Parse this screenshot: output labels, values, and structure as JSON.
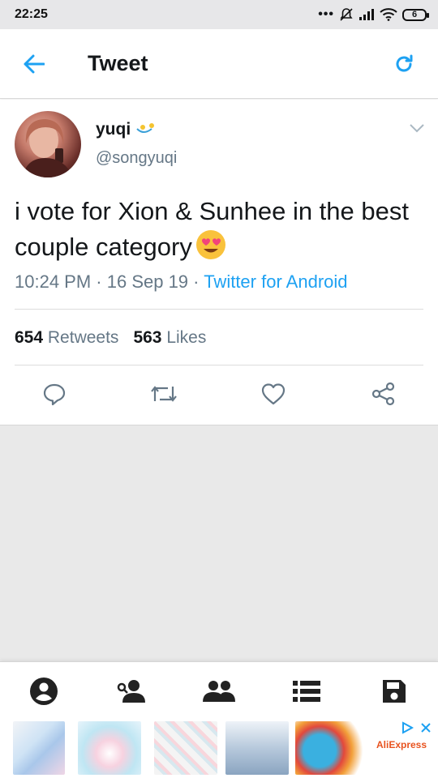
{
  "status_bar": {
    "time": "22:25",
    "battery": "6"
  },
  "header": {
    "title": "Tweet",
    "back_icon": "arrow-left-icon",
    "refresh_icon": "refresh-icon",
    "accent_color": "#1da1f2"
  },
  "tweet": {
    "display_name": "yuqi",
    "handle": "@songyuqi",
    "text": "i vote for Xion & Sunhee in the best couple category",
    "time": "10:24 PM",
    "date": "16 Sep 19",
    "source": "Twitter for Android",
    "retweets_count": "654",
    "retweets_label": "Retweets",
    "likes_count": "563",
    "likes_label": "Likes"
  },
  "bottom_nav": {
    "items": [
      "account-icon",
      "person-search-icon",
      "group-icon",
      "list-icon",
      "save-icon"
    ]
  },
  "ad": {
    "brand": "AliExpress"
  }
}
